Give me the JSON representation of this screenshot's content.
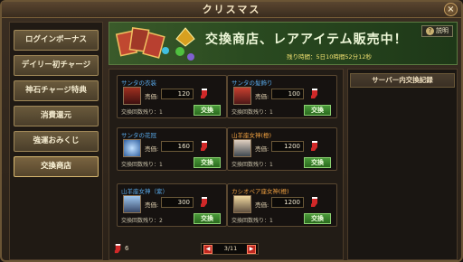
{
  "window": {
    "title": "クリスマス",
    "close_label": "×"
  },
  "sidebar": {
    "items": [
      {
        "label": "ログインボーナス"
      },
      {
        "label": "デイリー初チャージ"
      },
      {
        "label": "神石チャージ特典"
      },
      {
        "label": "消費還元"
      },
      {
        "label": "強運おみくじ"
      },
      {
        "label": "交換商店",
        "active": true
      }
    ]
  },
  "banner": {
    "title": "交換商店、レアアイテム販売中！",
    "subtitle": "残り時間：5日10時間52分12秒",
    "help_label": "説明",
    "help_glyph": "?"
  },
  "cards": [
    {
      "name": "サンタの衣装",
      "name_color": "blue",
      "price_label": "売価:",
      "price": "120",
      "remain": "交換回数残り：1",
      "button": "交換"
    },
    {
      "name": "サンタの髪飾り",
      "name_color": "blue",
      "price_label": "売価:",
      "price": "100",
      "remain": "交換回数残り：1",
      "button": "交換"
    },
    {
      "name": "サンタの花冠",
      "name_color": "blue",
      "price_label": "売価:",
      "price": "160",
      "remain": "交換回数残り：1",
      "button": "交換"
    },
    {
      "name": "山羊座女神(橙)",
      "name_color": "orange",
      "price_label": "売価:",
      "price": "1200",
      "remain": "交換回数残り：1",
      "button": "交換"
    },
    {
      "name": "山羊座女神（紫）",
      "name_color": "blue",
      "price_label": "売価:",
      "price": "300",
      "remain": "交換回数残り：2",
      "button": "交換"
    },
    {
      "name": "カシオペア座女神(橙)",
      "name_color": "orange",
      "price_label": "売価:",
      "price": "1200",
      "remain": "交換回数残り：1",
      "button": "交換"
    }
  ],
  "log_panel": {
    "header": "サーバー内交換記録"
  },
  "footer": {
    "sock_count": "6",
    "page": "3/11",
    "prev": "◀",
    "next": "▶"
  },
  "colors": {
    "accent_green": "#3a8a2e",
    "name_blue": "#58a8e8",
    "name_orange": "#f0a040",
    "frame_gold": "#a08858"
  }
}
